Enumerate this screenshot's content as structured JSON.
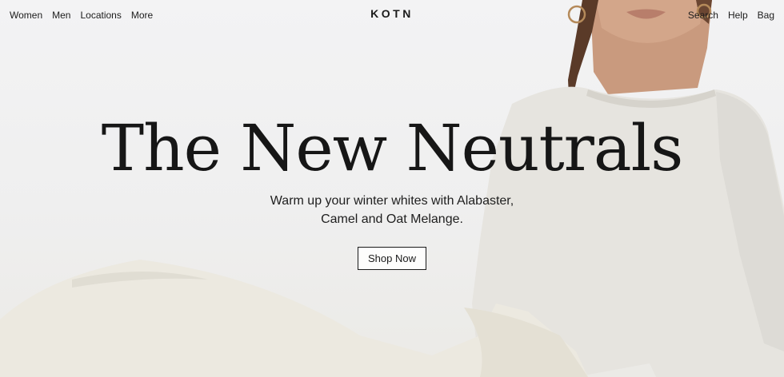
{
  "nav": {
    "left": [
      "Women",
      "Men",
      "Locations",
      "More"
    ],
    "brand": "KOTN",
    "right": [
      "Search",
      "Help",
      "Bag"
    ]
  },
  "hero": {
    "headline": "The New Neutrals",
    "subhead_line1": "Warm up your winter whites with Alabaster,",
    "subhead_line2": "Camel and Oat Melange.",
    "cta": "Shop Now"
  },
  "colors": {
    "background": "#f0f0f0",
    "text": "#1a1a1a",
    "garment": "#e6e4de",
    "skin": "#c89678"
  }
}
